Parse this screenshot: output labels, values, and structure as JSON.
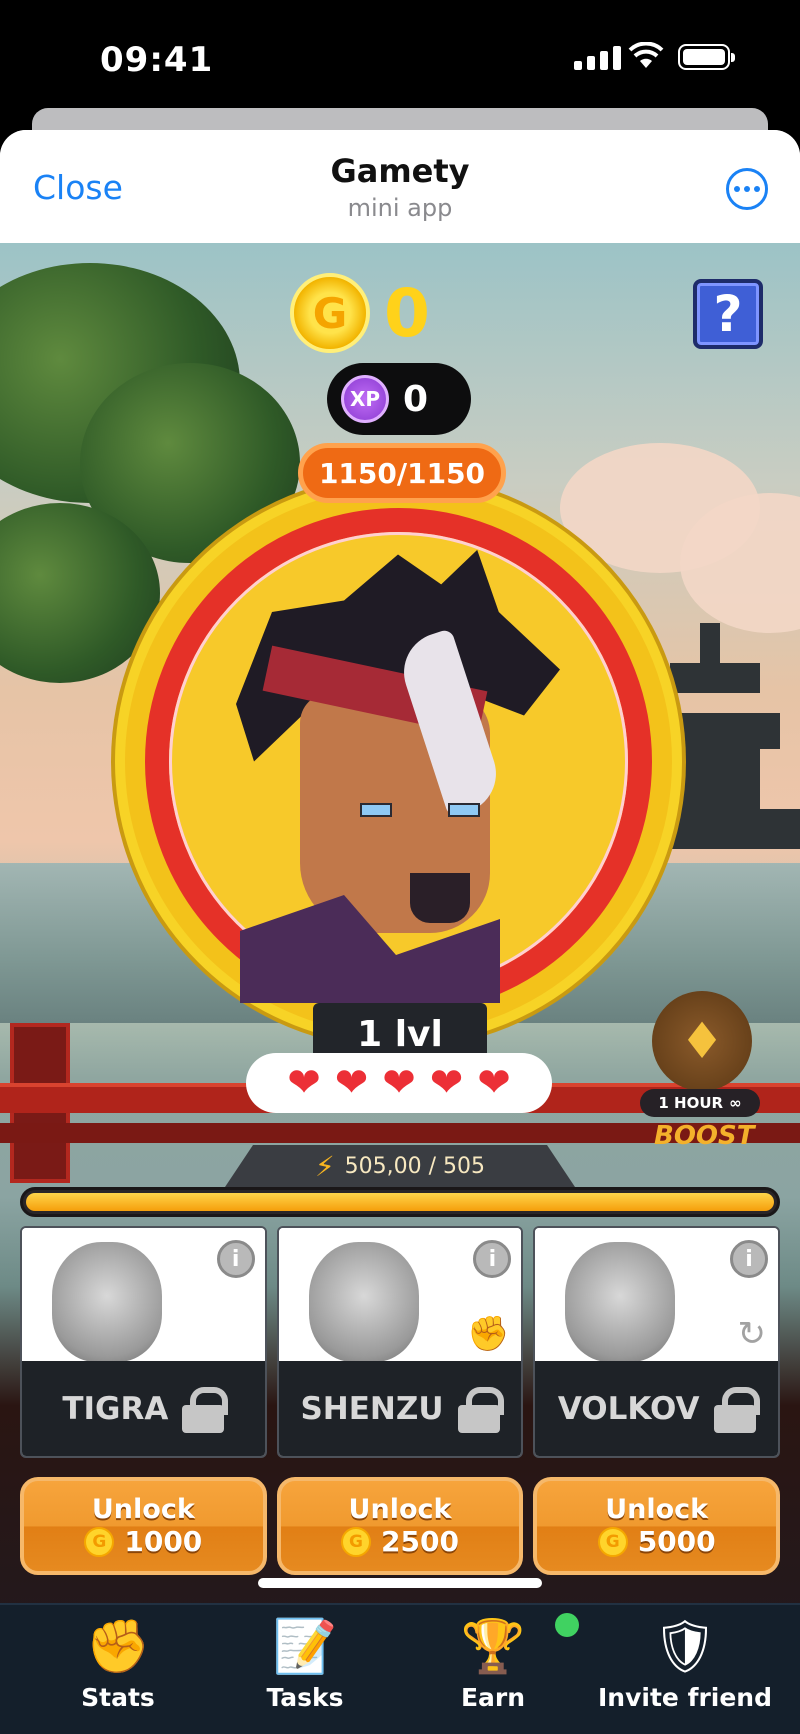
{
  "status_bar": {
    "time": "09:41"
  },
  "header": {
    "close_label": "Close",
    "title": "Gamety",
    "subtitle": "mini app"
  },
  "game": {
    "coins": "0",
    "coin_icon_letter": "G",
    "xp_label": "XP",
    "xp_value": "0",
    "help_label": "?",
    "hp": "1150/1150",
    "level": "1 lvl",
    "hearts": [
      "❤",
      "❤",
      "❤",
      "❤",
      "❤"
    ],
    "boost": {
      "duration": "1 HOUR",
      "infinity": "∞",
      "label": "BOOST"
    },
    "energy": {
      "text": "505,00 / 505",
      "fraction": 1.0
    },
    "characters": [
      {
        "name": "TIGRA",
        "unlock_label": "Unlock",
        "price": "1000",
        "info": "i",
        "icon": ""
      },
      {
        "name": "SHENZU",
        "unlock_label": "Unlock",
        "price": "2500",
        "info": "i",
        "icon": "fist-icon"
      },
      {
        "name": "VOLKOV",
        "unlock_label": "Unlock",
        "price": "5000",
        "info": "i",
        "icon": "energy-refresh-icon"
      }
    ]
  },
  "nav": {
    "items": [
      {
        "label": "Stats",
        "icon": "fist-fire-icon"
      },
      {
        "label": "Tasks",
        "icon": "notepad-icon"
      },
      {
        "label": "Earn",
        "icon": "trophy-icon"
      },
      {
        "label": "Invite friend",
        "icon": "shield-plus-icon"
      }
    ]
  },
  "colors": {
    "accent": "#1a82f5",
    "gold": "#ffd21a",
    "orange": "#f09a2f",
    "hp": "#ef6a14",
    "nav_bg": "#141f2b"
  }
}
